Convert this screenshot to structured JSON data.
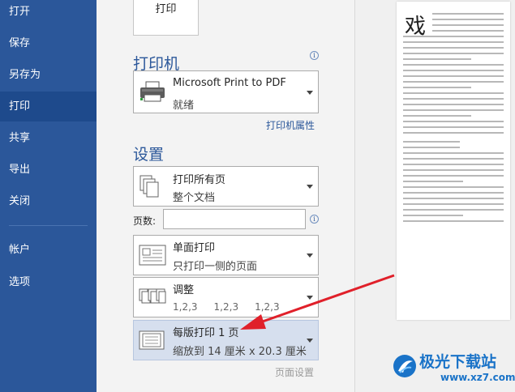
{
  "sidebar": {
    "items": [
      {
        "label": "打开"
      },
      {
        "label": "保存"
      },
      {
        "label": "另存为"
      },
      {
        "label": "打印"
      },
      {
        "label": "共享"
      },
      {
        "label": "导出"
      },
      {
        "label": "关闭"
      },
      {
        "label": "帐户"
      },
      {
        "label": "选项"
      }
    ],
    "active": "打印"
  },
  "print_button": {
    "label": "打印"
  },
  "printer": {
    "section_title": "打印机",
    "name": "Microsoft Print to PDF",
    "status": "就绪",
    "properties_link": "打印机属性"
  },
  "settings": {
    "section_title": "设置",
    "print_range": {
      "title": "打印所有页",
      "subtitle": "整个文档"
    },
    "pages_label": "页数:",
    "pages_value": "",
    "sides": {
      "title": "单面打印",
      "subtitle": "只打印一侧的页面"
    },
    "collate": {
      "title": "调整",
      "order": [
        "1,2,3",
        "1,2,3",
        "1,2,3"
      ]
    },
    "pages_per_sheet": {
      "title": "每版打印 1 页",
      "subtitle": "缩放到 14 厘米 x 20.3 厘米"
    },
    "page_setup_link": "页面设置"
  },
  "preview": {
    "title_char": "戏"
  },
  "watermark": {
    "text": "极光下载站",
    "url": "www.xz7.com"
  },
  "colors": {
    "sidebar": "#2b579a",
    "accent": "#2b579a",
    "arrow": "#e0202a"
  }
}
